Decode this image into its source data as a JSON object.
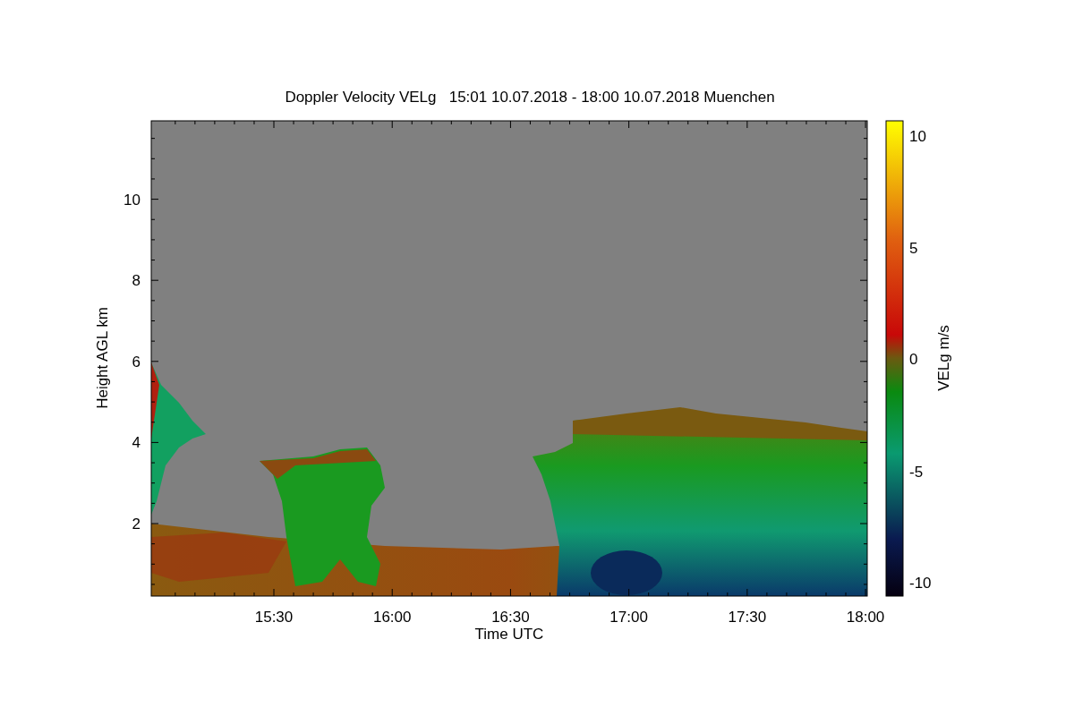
{
  "plot": {
    "title": "Doppler Velocity VELg   15:01 10.07.2018 - 18:00 10.07.2018 Muenchen",
    "xlabel": "Time UTC",
    "ylabel": "Height AGL km",
    "xticks": [
      "15:30",
      "16:00",
      "16:30",
      "17:00",
      "17:30",
      "18:00"
    ],
    "yticks": [
      "10",
      "8",
      "6",
      "4",
      "2"
    ]
  },
  "colorbar": {
    "label": "VELg m/s",
    "ticks": [
      "10",
      "5",
      "0",
      "-5",
      "-10"
    ]
  }
}
